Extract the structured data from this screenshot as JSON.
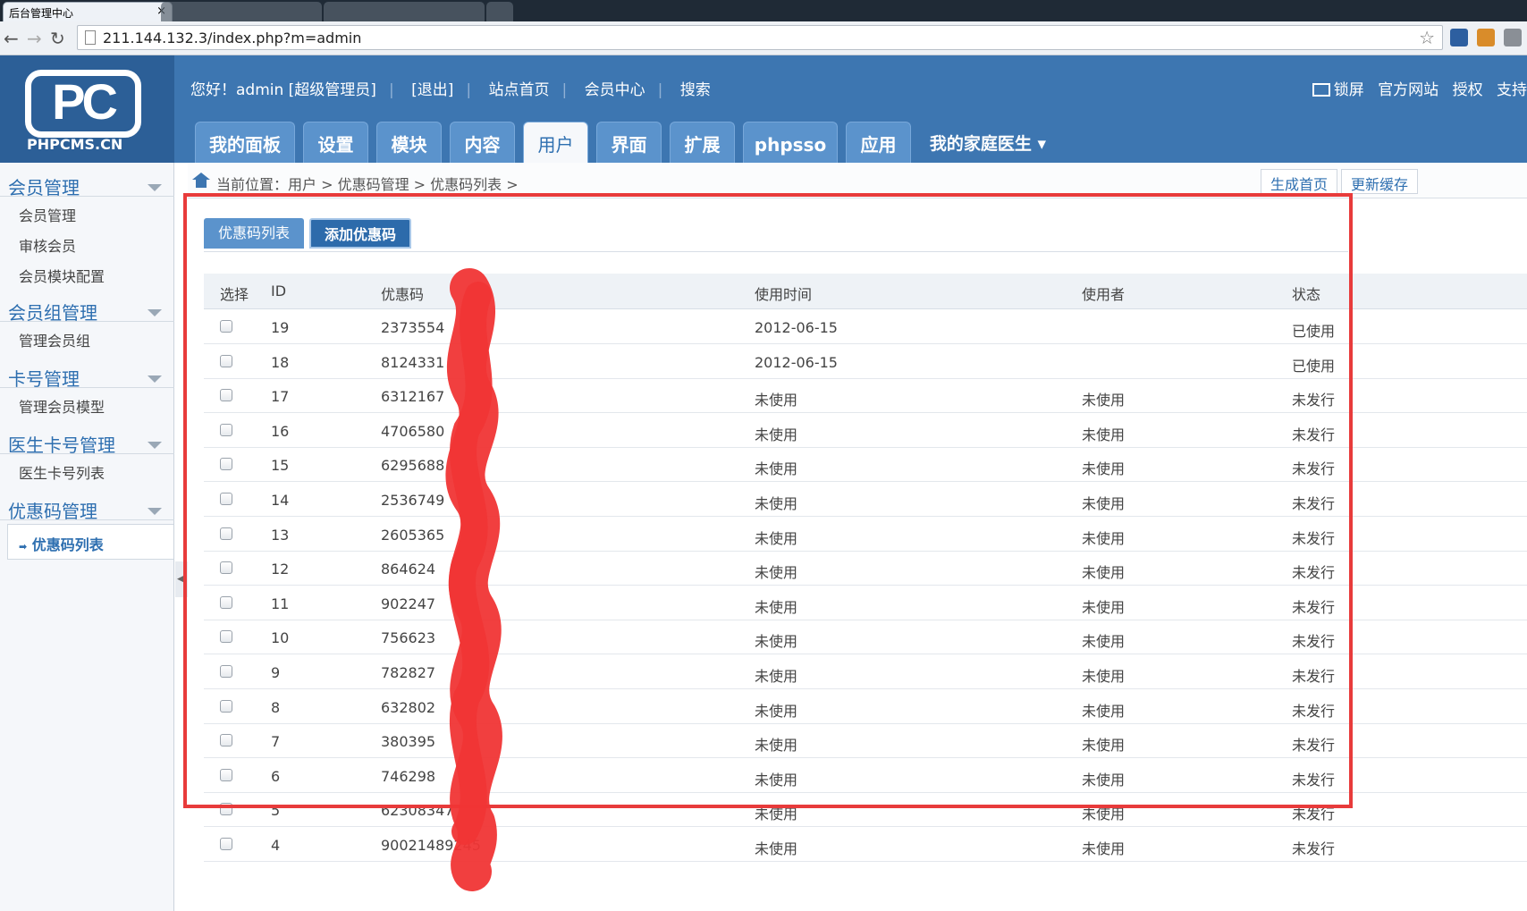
{
  "browser": {
    "tab_title": "后台管理中心",
    "tab_close": "×",
    "url": "211.144.132.3/index.php?m=admin",
    "back": "←",
    "forward": "→",
    "reload": "↻",
    "star": "☆"
  },
  "header": {
    "logo_text": "PHPCMS.CN",
    "logo_mark": "PC",
    "greeting": "您好！admin [超级管理员]",
    "logout": "[退出]",
    "site_home": "站点首页",
    "member_center": "会员中心",
    "search": "搜索",
    "lock_screen": "锁屏",
    "official_site": "官方网站",
    "license": "授权",
    "support": "支持"
  },
  "main_nav": [
    {
      "label": "我的面板"
    },
    {
      "label": "设置"
    },
    {
      "label": "模块"
    },
    {
      "label": "内容"
    },
    {
      "label": "用户",
      "active": true
    },
    {
      "label": "界面"
    },
    {
      "label": "扩展"
    },
    {
      "label": "phpsso"
    },
    {
      "label": "应用"
    }
  ],
  "site_menu": "我的家庭医生",
  "sidebar": {
    "groups": [
      {
        "title": "会员管理",
        "items": [
          "会员管理",
          "审核会员",
          "会员模块配置"
        ]
      },
      {
        "title": "会员组管理",
        "items": [
          "管理会员组"
        ]
      },
      {
        "title": "卡号管理",
        "items": [
          "管理会员模型"
        ]
      },
      {
        "title": "医生卡号管理",
        "items": [
          "医生卡号列表"
        ]
      },
      {
        "title": "优惠码管理",
        "items": [
          "优惠码列表"
        ]
      }
    ]
  },
  "breadcrumb": "当前位置：用户 > 优惠码管理 > 优惠码列表 >",
  "actions": {
    "generate_home": "生成首页",
    "update_cache": "更新缓存"
  },
  "subtabs": {
    "list": "优惠码列表",
    "add": "添加优惠码"
  },
  "table": {
    "headers": [
      "选择",
      "ID",
      "优惠码",
      "使用时间",
      "使用者",
      "状态"
    ],
    "rows": [
      {
        "id": "19",
        "code": "2373554",
        "time": "2012-06-15",
        "user": "",
        "status": "已使用"
      },
      {
        "id": "18",
        "code": "8124331",
        "time": "2012-06-15",
        "user": "",
        "status": "已使用"
      },
      {
        "id": "17",
        "code": "6312167",
        "time": "未使用",
        "user": "未使用",
        "status": "未发行"
      },
      {
        "id": "16",
        "code": "4706580",
        "time": "未使用",
        "user": "未使用",
        "status": "未发行"
      },
      {
        "id": "15",
        "code": "6295688",
        "time": "未使用",
        "user": "未使用",
        "status": "未发行"
      },
      {
        "id": "14",
        "code": "2536749",
        "time": "未使用",
        "user": "未使用",
        "status": "未发行"
      },
      {
        "id": "13",
        "code": "2605365",
        "time": "未使用",
        "user": "未使用",
        "status": "未发行"
      },
      {
        "id": "12",
        "code": "864624",
        "time": "未使用",
        "user": "未使用",
        "status": "未发行"
      },
      {
        "id": "11",
        "code": "902247",
        "time": "未使用",
        "user": "未使用",
        "status": "未发行"
      },
      {
        "id": "10",
        "code": "756623",
        "time": "未使用",
        "user": "未使用",
        "status": "未发行"
      },
      {
        "id": "9",
        "code": "782827",
        "time": "未使用",
        "user": "未使用",
        "status": "未发行"
      },
      {
        "id": "8",
        "code": "632802",
        "time": "未使用",
        "user": "未使用",
        "status": "未发行"
      },
      {
        "id": "7",
        "code": "380395",
        "time": "未使用",
        "user": "未使用",
        "status": "未发行"
      },
      {
        "id": "6",
        "code": "746298",
        "time": "未使用",
        "user": "未使用",
        "status": "未发行"
      },
      {
        "id": "5",
        "code": "62308347",
        "time": "未使用",
        "user": "未使用",
        "status": "未发行"
      },
      {
        "id": "4",
        "code": "90021489245",
        "time": "未使用",
        "user": "未使用",
        "status": "未发行"
      }
    ]
  },
  "colors": {
    "header_blue": "#3d76b1",
    "accent": "#2e6fb0",
    "annotation_red": "#e83b3b"
  }
}
